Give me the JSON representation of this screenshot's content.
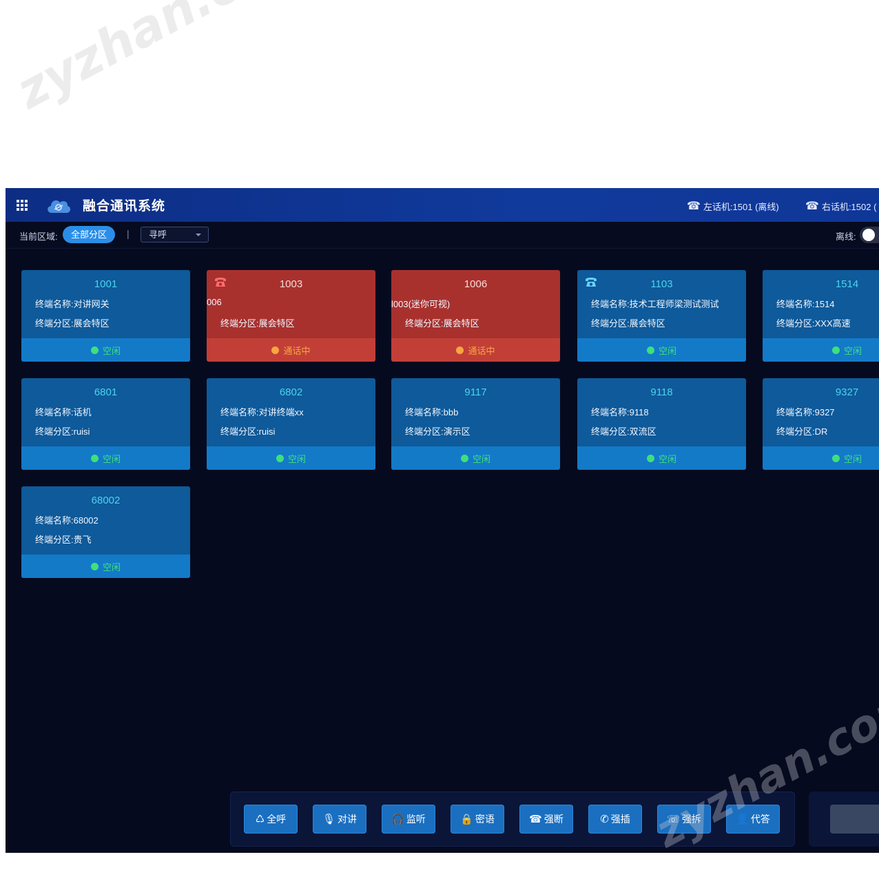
{
  "header": {
    "title": "融合通讯系统",
    "left_phone": "左话机:1501 (离线)",
    "right_phone": "右话机:1502 ("
  },
  "toolbar": {
    "area_label": "当前区域:",
    "area_value": "全部分区",
    "separator": "|",
    "select_value": "寻呼",
    "offline_label": "离线:"
  },
  "cards": [
    {
      "number": "1001",
      "line1": "终端名称:对讲网关",
      "line2": "终端分区:展会特区",
      "status": "空闲"
    },
    {
      "number": "1003",
      "line1": "006",
      "line2": "终端分区:展会特区",
      "status": "通话中"
    },
    {
      "number": "1006",
      "line1": "l003(迷你可视)",
      "line2": "终端分区:展会特区",
      "status": "通话中"
    },
    {
      "number": "1103",
      "line1": "终端名称:技术工程师梁测试测试",
      "line2": "终端分区:展会特区",
      "status": "空闲"
    },
    {
      "number": "1514",
      "line1": "终端名称:1514",
      "line2": "终端分区:XXX高速",
      "status": "空闲"
    },
    {
      "number": "6801",
      "line1": "终端名称:话机",
      "line2": "终端分区:ruisi",
      "status": "空闲"
    },
    {
      "number": "6802",
      "line1": "终端名称:对讲终端xx",
      "line2": "终端分区:ruisi",
      "status": "空闲"
    },
    {
      "number": "9117",
      "line1": "终端名称:bbb",
      "line2": "终端分区:演示区",
      "status": "空闲"
    },
    {
      "number": "9118",
      "line1": "终端名称:9118",
      "line2": "终端分区:双流区",
      "status": "空闲"
    },
    {
      "number": "9327",
      "line1": "终端名称:9327",
      "line2": "终端分区:DR",
      "status": "空闲"
    },
    {
      "number": "68002",
      "line1": "终端名称:68002",
      "line2": "终端分区:贵飞",
      "status": "空闲"
    }
  ],
  "actions": [
    {
      "label": "全呼",
      "icon": "recycle-icon",
      "glyph": "♺"
    },
    {
      "label": "对讲",
      "icon": "microphone-icon",
      "glyph": "🎙"
    },
    {
      "label": "监听",
      "icon": "headphones-icon",
      "glyph": "🎧"
    },
    {
      "label": "密语",
      "icon": "lock-icon",
      "glyph": "🔒"
    },
    {
      "label": "强断",
      "icon": "hangup-icon",
      "glyph": "☎"
    },
    {
      "label": "强插",
      "icon": "phone-forward-icon",
      "glyph": "✆"
    },
    {
      "label": "强拆",
      "icon": "phone-transfer-icon",
      "glyph": "☏"
    },
    {
      "label": "代答",
      "icon": "user-icon",
      "glyph": "👤"
    }
  ],
  "watermark": "zyzhan.com",
  "colors": {
    "titlebar": "#103a9c",
    "background": "#060a1e",
    "idle_card": "#0e5a9a",
    "busy_card": "#a8312e",
    "idle_status": "#3ee07a",
    "busy_status": "#f7a641",
    "accent": "#2a8ee8"
  }
}
